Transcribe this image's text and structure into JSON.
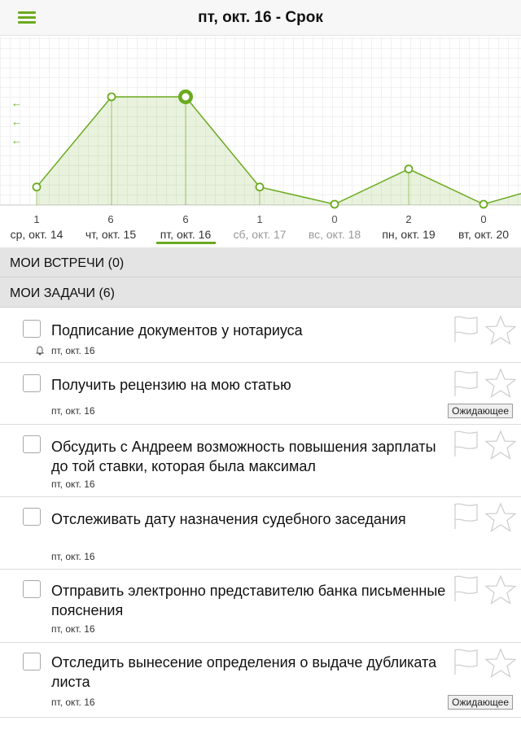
{
  "header": {
    "title": "пт, окт. 16 - Срок",
    "menu_icon": "hamburger-menu-icon"
  },
  "colors": {
    "accent": "#6aaa1e",
    "section_bg": "#e4e4e4"
  },
  "chart_data": {
    "type": "area",
    "categories": [
      "ср, окт. 14",
      "чт, окт. 15",
      "пт, окт. 16",
      "сб, окт. 17",
      "вс, окт. 18",
      "пн, окт. 19",
      "вт, окт. 20"
    ],
    "values": [
      1,
      6,
      6,
      1,
      0,
      2,
      0
    ],
    "selected_index": 2,
    "ylim": [
      0,
      6
    ],
    "grid": true
  },
  "days": [
    {
      "count": "1",
      "label": "ср, окт. 14"
    },
    {
      "count": "6",
      "label": "чт, окт. 15"
    },
    {
      "count": "6",
      "label": "пт, окт. 16"
    },
    {
      "count": "1",
      "label": "сб, окт. 17"
    },
    {
      "count": "0",
      "label": "вс, окт. 18"
    },
    {
      "count": "2",
      "label": "пн, окт. 19"
    },
    {
      "count": "0",
      "label": "вт, окт. 20"
    }
  ],
  "sections": {
    "meetings": "МОИ ВСТРЕЧИ (0)",
    "tasks": "МОИ ЗАДАЧИ (6)"
  },
  "tasks": [
    {
      "title": "Подписание документов у нотариуса",
      "date": "пт, окт. 16",
      "status": "",
      "alarm": true
    },
    {
      "title": "Получить рецензию на мою статью",
      "date": "пт, окт. 16",
      "status": "Ожидающее"
    },
    {
      "title": "Обсудить с Андреем возможность повышения зарплаты до той ставки, которая была максимал",
      "date": "пт, окт. 16",
      "status": ""
    },
    {
      "title": "Отслеживать дату назначения судебного заседания",
      "date": "пт, окт. 16",
      "status": ""
    },
    {
      "title": "Отправить электронно представителю банка письменные пояснения",
      "date": "пт, окт. 16",
      "status": ""
    },
    {
      "title": "Отследить вынесение определения о выдаче дубликата листа",
      "date": "пт, окт. 16",
      "status": "Ожидающее"
    }
  ]
}
